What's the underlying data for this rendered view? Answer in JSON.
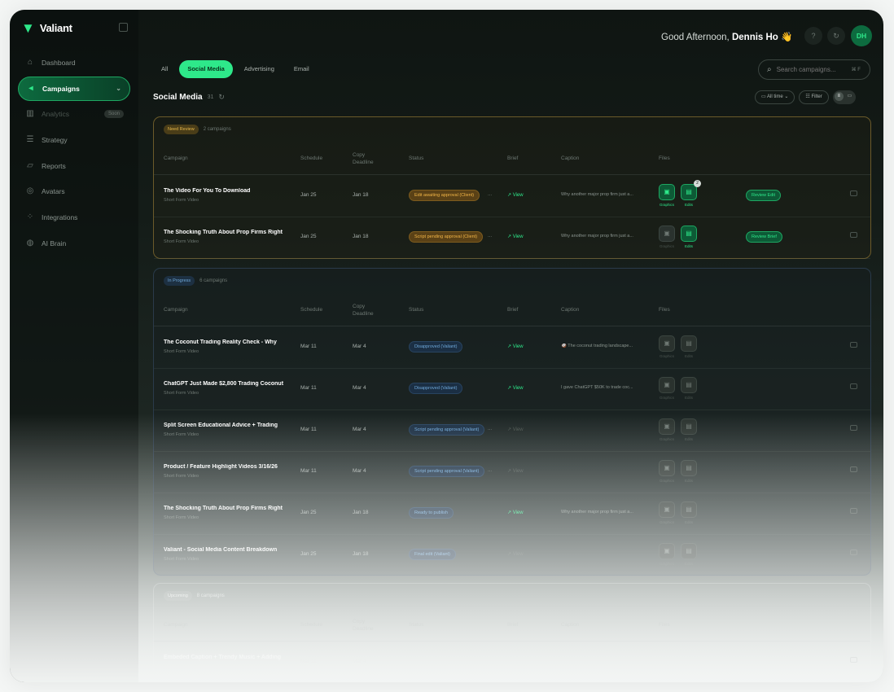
{
  "brand": {
    "name": "Valiant"
  },
  "nav": [
    {
      "label": "Dashboard",
      "icon": "home-icon",
      "state": "normal"
    },
    {
      "label": "Campaigns",
      "icon": "megaphone-icon",
      "state": "active"
    },
    {
      "label": "Analytics",
      "icon": "bar-chart-icon",
      "state": "dim",
      "badge": "Soon"
    },
    {
      "label": "Strategy",
      "icon": "list-icon",
      "state": "normal"
    },
    {
      "label": "Reports",
      "icon": "folder-icon",
      "state": "normal"
    },
    {
      "label": "Avatars",
      "icon": "user-icon",
      "state": "normal"
    },
    {
      "label": "Integrations",
      "icon": "grid-icon",
      "state": "normal"
    },
    {
      "label": "AI Brain",
      "icon": "brain-icon",
      "state": "normal"
    }
  ],
  "header": {
    "greeting": "Good Afternoon,",
    "user": "Dennis Ho",
    "wave": "👋",
    "avatar": "DH",
    "help": "?",
    "refresh": "↻"
  },
  "tabs": [
    {
      "label": "All",
      "active": false
    },
    {
      "label": "Social Media",
      "active": true
    },
    {
      "label": "Advertising",
      "active": false
    },
    {
      "label": "Email",
      "active": false
    }
  ],
  "search": {
    "placeholder": "Search campaigns...",
    "shortcut": "⌘ F"
  },
  "page": {
    "title": "Social Media",
    "count": "31"
  },
  "filters": {
    "time": "All time",
    "filter": "Filter"
  },
  "columns": {
    "campaign": "Campaign",
    "schedule": "Schedule",
    "deadline": "Copy Deadline",
    "status": "Status",
    "brief": "Brief",
    "caption": "Caption",
    "files": "Files"
  },
  "groups": {
    "review": {
      "badge": "Need Review",
      "count": "2 campaigns",
      "rows": [
        {
          "name": "The Video For You To Download",
          "sub": "Short Form Video",
          "schedule": "Jan 25",
          "deadline": "Jan 18",
          "status": "Edit awaiting approval (Client)",
          "brief": "View",
          "caption": "Why another major prop firm just a...",
          "files": [
            {
              "label": "Graphics",
              "on": true
            },
            {
              "label": "Edits",
              "on": true,
              "notif": "2"
            }
          ],
          "action": "Review Edit"
        },
        {
          "name": "The Shocking Truth About Prop Firms Right",
          "sub": "Short Form Video",
          "schedule": "Jan 25",
          "deadline": "Jan 18",
          "status": "Script pending approval (Client)",
          "brief": "View",
          "caption": "Why another major prop firm just a...",
          "files": [
            {
              "label": "Graphics",
              "on": false
            },
            {
              "label": "Edits",
              "on": true
            }
          ],
          "action": "Review Brief"
        }
      ]
    },
    "progress": {
      "badge": "In Progress",
      "count": "6 campaigns",
      "rows": [
        {
          "name": "The Coconut Trading Reality Check - Why",
          "sub": "Short Form Video",
          "schedule": "Mar 11",
          "deadline": "Mar 4",
          "status": "Disapproved (Valiant)",
          "brief": "View",
          "caption": "🥥 The coconut trading landscape...",
          "files": [
            {
              "label": "Graphics",
              "on": false
            },
            {
              "label": "Edits",
              "on": false
            }
          ]
        },
        {
          "name": "ChatGPT Just Made $2,800 Trading Coconut",
          "sub": "Short Form Video",
          "schedule": "Mar 11",
          "deadline": "Mar 4",
          "status": "Disapproved (Valiant)",
          "brief": "View",
          "caption": "I gave ChatGPT $50K to trade coc...",
          "files": [
            {
              "label": "Graphics",
              "on": false
            },
            {
              "label": "Edits",
              "on": false
            }
          ]
        },
        {
          "name": "Split Screen Educational Advice + Trading",
          "sub": "Short Form Video",
          "schedule": "Mar 11",
          "deadline": "Mar 4",
          "status": "Script pending approval (Valiant)",
          "brief": "View",
          "caption": "",
          "files": [
            {
              "label": "Graphics",
              "on": false
            },
            {
              "label": "Edits",
              "on": false
            }
          ]
        },
        {
          "name": "Product / Feature Highlight Videos 3/16/26",
          "sub": "Short Form Video",
          "schedule": "Mar 11",
          "deadline": "Mar 4",
          "status": "Script pending approval (Valiant)",
          "brief": "View",
          "caption": "",
          "files": [
            {
              "label": "Graphics",
              "on": false
            },
            {
              "label": "Edits",
              "on": false
            }
          ]
        },
        {
          "name": "The Shocking Truth About Prop Firms Right",
          "sub": "Short Form Video",
          "schedule": "Jan 25",
          "deadline": "Jan 18",
          "status": "Ready to publish",
          "brief": "View",
          "caption": "Why another major prop firm just a...",
          "files": [
            {
              "label": "Graphics",
              "on": false
            },
            {
              "label": "Edits",
              "on": false
            }
          ]
        },
        {
          "name": "Valiant - Social Media Content Breakdown",
          "sub": "Short Form Video",
          "schedule": "Jan 25",
          "deadline": "Jan 18",
          "status": "Final edit (Valiant)",
          "brief": "View",
          "caption": "",
          "files": [
            {
              "label": "Graphics",
              "on": false
            },
            {
              "label": "Edits",
              "on": false
            }
          ]
        }
      ]
    },
    "third": {
      "badge": "Upcoming",
      "count": "8 campaigns",
      "rows": [
        {
          "name": "Embeded Caption + Trendy Music + Adding",
          "sub": "",
          "schedule": "Mar 11",
          "deadline": "Mar 4",
          "status": "",
          "brief": "",
          "caption": "",
          "files": []
        }
      ]
    }
  },
  "colors": {
    "accent": "#2ee88a",
    "review_border": "#6b5a2a",
    "progress_border": "#2a3a4a"
  }
}
